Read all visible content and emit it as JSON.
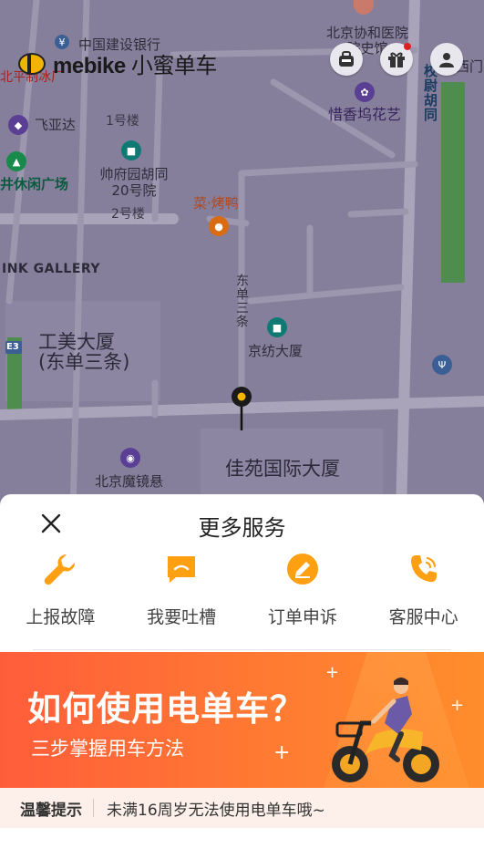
{
  "app": {
    "brand_latin": "mebike",
    "brand_cn": "小蜜单车"
  },
  "map": {
    "labels": {
      "bank": "中国建设银行",
      "hospital_history": "北京协和医院院史馆",
      "ice_factory": "北平制冰厂",
      "feiyada": "飞亚达",
      "bldg1": "1号楼",
      "shuaifu": "帅府园胡同20号院",
      "bldg2": "2号楼",
      "plaza": "井休闲广场",
      "xiaoyu": "校尉胡同",
      "ximen": "西门",
      "xixiang": "惜香坞花艺",
      "roast_duck": "菜·烤鸭",
      "gallery": "INK GALLERY",
      "gongmei": "工美大厦(东单三条)",
      "dongdan": "东单三条",
      "jingfang": "京纺大厦",
      "jiayuan": "佳苑国际大厦",
      "mojing": "北京魔镜悬",
      "road_badge": "E3"
    }
  },
  "sheet": {
    "title": "更多服务",
    "services": [
      {
        "label": "上报故障",
        "icon": "wrench-icon"
      },
      {
        "label": "我要吐槽",
        "icon": "message-icon"
      },
      {
        "label": "订单申诉",
        "icon": "edit-icon"
      },
      {
        "label": "客服中心",
        "icon": "phone-icon"
      }
    ],
    "banner": {
      "title": "如何使用电单车？",
      "subtitle": "三步掌握用车方法"
    },
    "tip": {
      "tag": "温馨提示",
      "text": "未满16周岁无法使用电单车哦~"
    }
  },
  "colors": {
    "accent_orange": "#ff9f12",
    "banner_start": "#ff5d3a",
    "banner_end": "#ff8d2c",
    "map_bg": "#857f9b"
  }
}
